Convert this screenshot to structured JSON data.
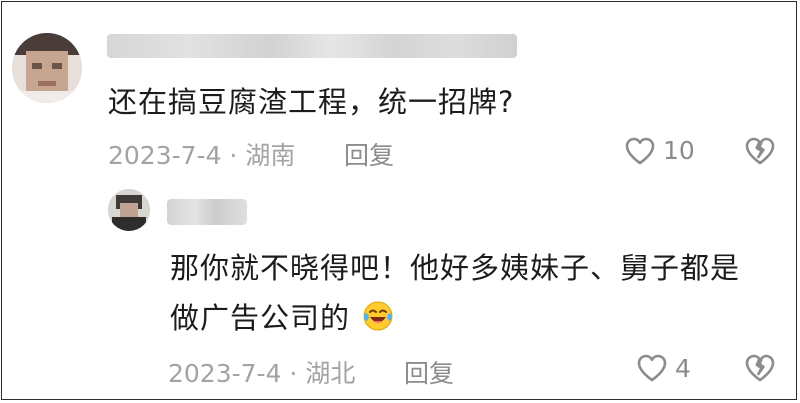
{
  "comment": {
    "text": "还在搞豆腐渣工程，统一招牌?",
    "meta": "2023-7-4 · 湖南",
    "reply_label": "回复",
    "like_count": "10"
  },
  "reply": {
    "text_line1": "那你就不晓得吧！他好多姨妹子、舅子都是",
    "text_line2": "做广告公司的",
    "emoji": "laughing-crying-emoji",
    "meta": "2023-7-4 · 湖北",
    "reply_label": "回复",
    "like_count": "4"
  },
  "colors": {
    "text": "#1c1c1c",
    "meta": "#a3a3a3",
    "icon": "#8c8c8c"
  }
}
